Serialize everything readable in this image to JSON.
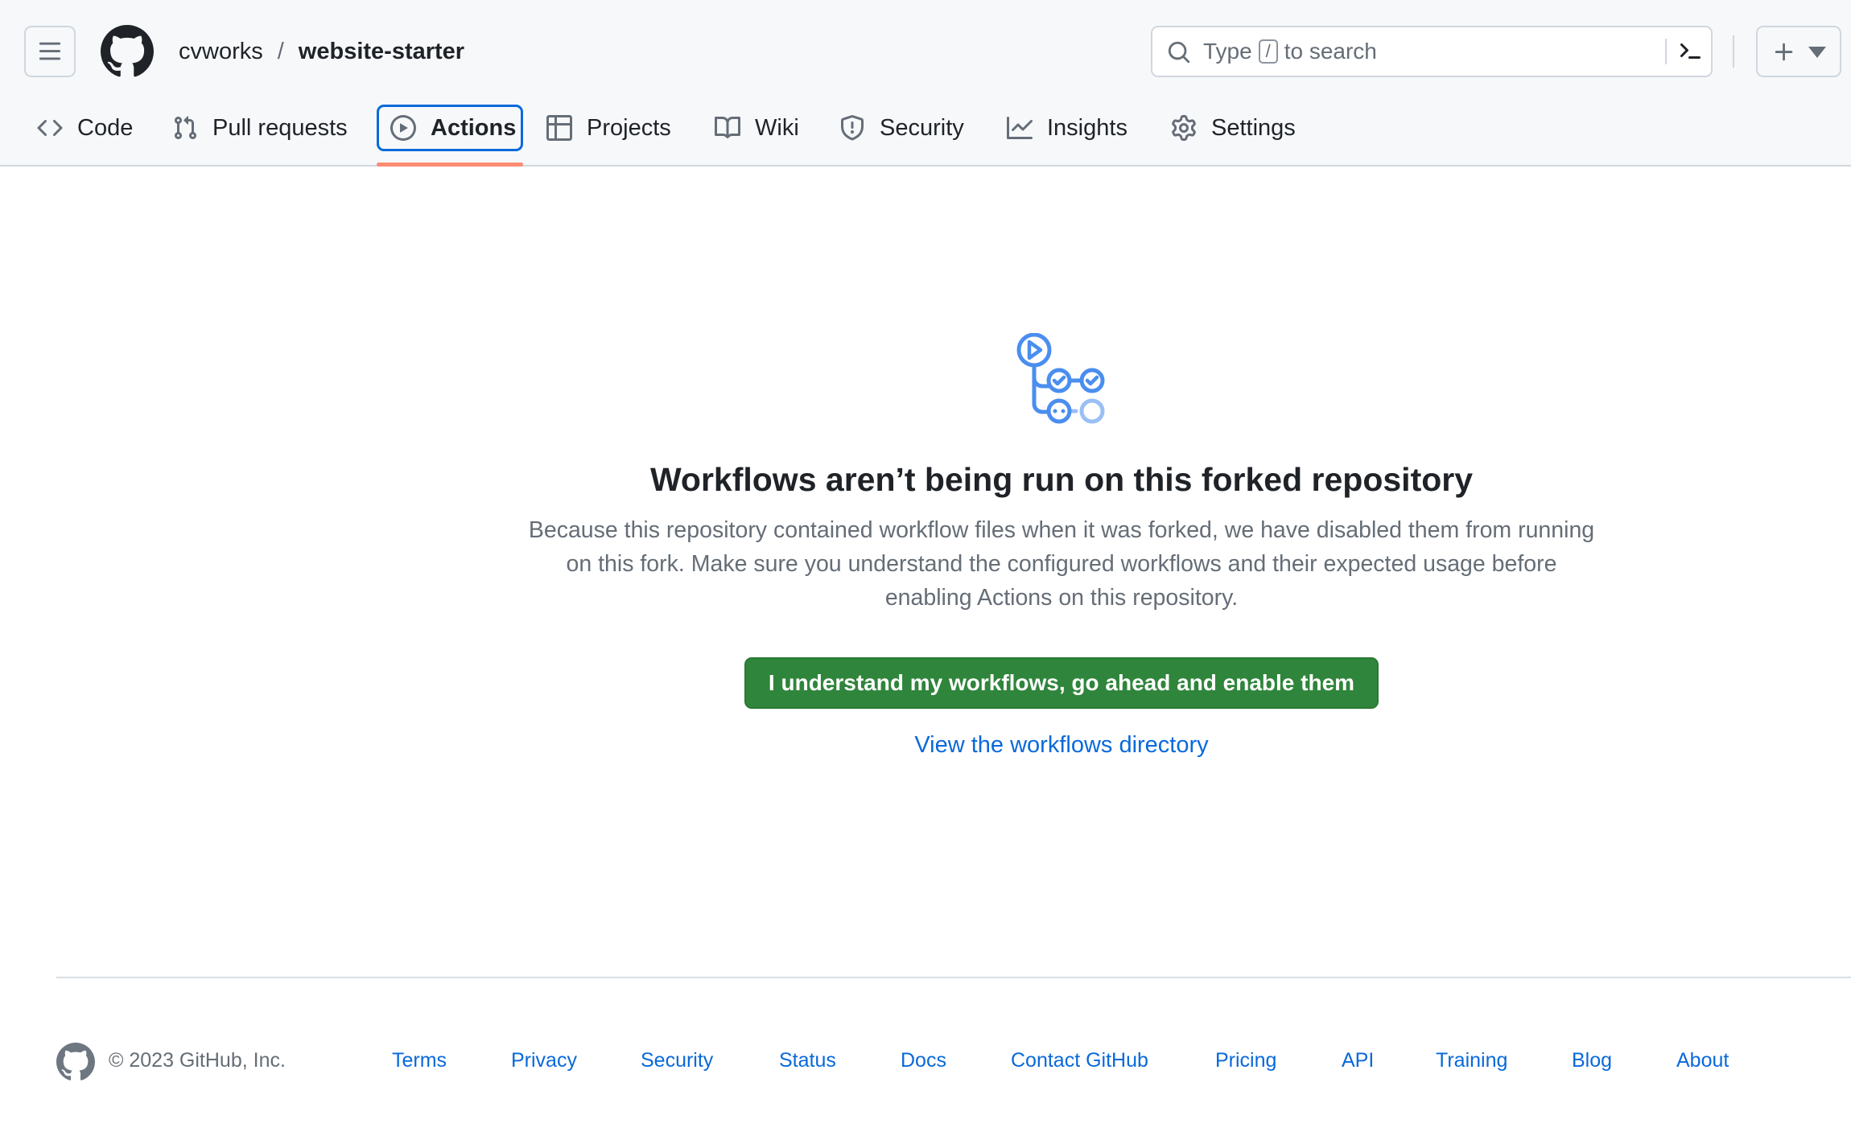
{
  "header": {
    "repo_owner": "cvworks",
    "repo_separator": "/",
    "repo_name": "website-starter",
    "search": {
      "prefix": "Type",
      "key": "/",
      "suffix": "to search"
    }
  },
  "tabs": [
    {
      "label": "Code",
      "icon": "code-icon"
    },
    {
      "label": "Pull requests",
      "icon": "git-pull-request-icon"
    },
    {
      "label": "Actions",
      "icon": "play-icon",
      "active": true
    },
    {
      "label": "Projects",
      "icon": "table-icon"
    },
    {
      "label": "Wiki",
      "icon": "book-icon"
    },
    {
      "label": "Security",
      "icon": "shield-icon"
    },
    {
      "label": "Insights",
      "icon": "graph-icon"
    },
    {
      "label": "Settings",
      "icon": "gear-icon"
    }
  ],
  "main": {
    "title": "Workflows aren’t being run on this forked repository",
    "description_lines": [
      "Because this repository contained workflow files when it was forked, we have disabled them from running",
      "on this fork. Make sure you understand the configured workflows and their expected usage before",
      "enabling Actions on this repository."
    ],
    "enable_button_label": "I understand my workflows, go ahead and enable them",
    "workflows_link_label": "View the workflows directory"
  },
  "footer": {
    "copyright": "© 2023 GitHub, Inc.",
    "links": [
      "Terms",
      "Privacy",
      "Security",
      "Status",
      "Docs",
      "Contact GitHub",
      "Pricing",
      "API",
      "Training",
      "Blog",
      "About"
    ]
  },
  "colors": {
    "accent": "#0969da",
    "active_tab_underline": "#fd8c73",
    "primary_button": "#2f853b",
    "header_background": "#f6f8fa",
    "muted_text": "#656d76"
  }
}
